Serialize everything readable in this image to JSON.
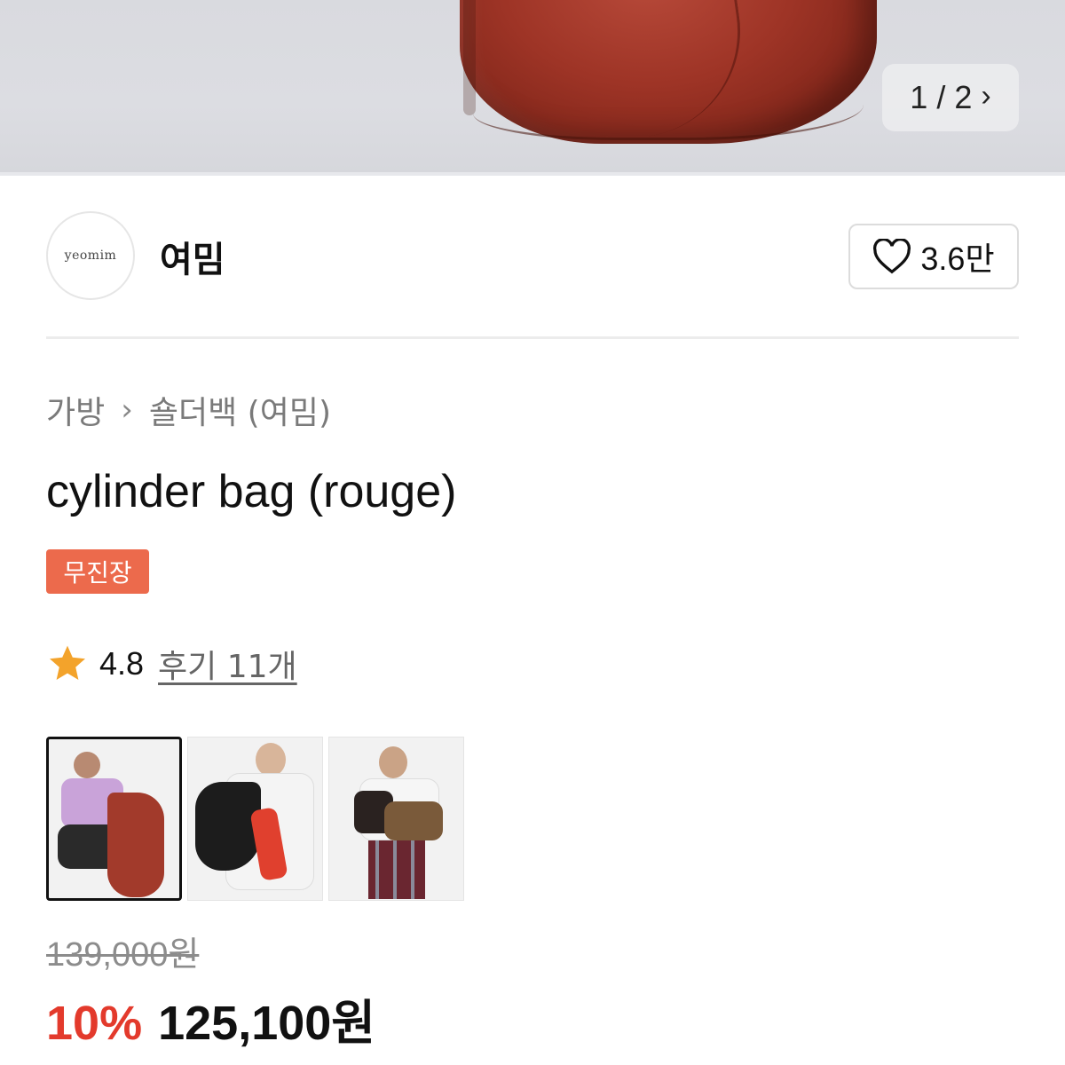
{
  "gallery": {
    "pager_text": "1 / 2",
    "pager_icon": "chevron-right-icon"
  },
  "seller": {
    "logo_text": "yeomim",
    "name": "여밈",
    "like_count": "3.6만",
    "like_icon": "heart-outline-icon"
  },
  "breadcrumb": {
    "category": "가방",
    "subcategory": "숄더백 (여밈)"
  },
  "product": {
    "title": "cylinder bag (rouge)",
    "badge": "무진장",
    "rating": "4.8",
    "reviews_label": "후기 11개",
    "original_price": "139,000원",
    "discount": "10%",
    "final_price": "125,100원"
  },
  "thumbnails": [
    {
      "label": "model with rouge bag, purple shirt",
      "active": true
    },
    {
      "label": "model with black bag, white outfit",
      "active": false
    },
    {
      "label": "model with brown bag, plaid skirt",
      "active": false
    }
  ],
  "colors": {
    "badge": "#ec6a4c",
    "discount": "#e33a2c",
    "star": "#f3a32b",
    "bag": "#9e3426"
  }
}
